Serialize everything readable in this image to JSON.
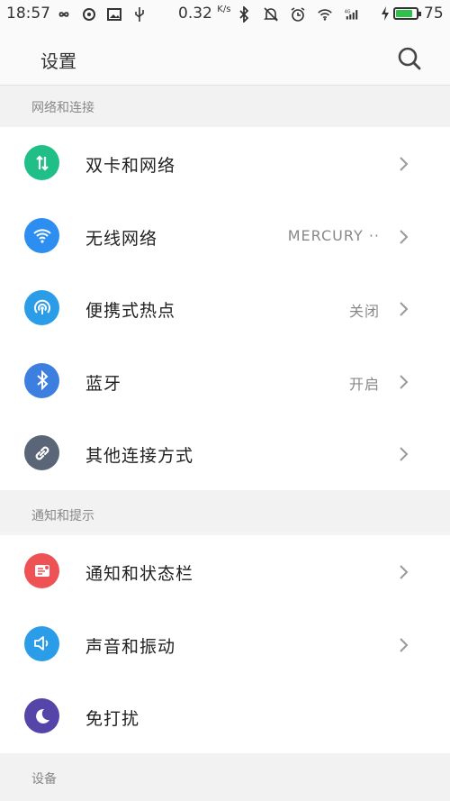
{
  "status_bar": {
    "time": "18:57",
    "net_speed": "0.32",
    "net_speed_unit": "K/s",
    "battery_level": "75",
    "battery_fill_fraction": 0.75,
    "left_icons": [
      "infinity-icon",
      "sync-icon",
      "image-icon",
      "usb-icon"
    ],
    "right_icons": [
      "bluetooth-icon",
      "mute-icon",
      "alarm-icon",
      "wifi-icon",
      "signal-4g-icon",
      "charging-icon"
    ]
  },
  "app_bar": {
    "title": "设置",
    "search_icon": "search-icon"
  },
  "sections": [
    {
      "header": "网络和连接",
      "items": [
        {
          "label": "双卡和网络",
          "value": "",
          "icon": "dual-sim-icon",
          "color": "#1fbf87"
        },
        {
          "label": "无线网络",
          "value": "MERCURY ··",
          "icon": "wifi-icon",
          "color": "#2b8ef0"
        },
        {
          "label": "便携式热点",
          "value": "关闭",
          "icon": "hotspot-icon",
          "color": "#2b9de8"
        },
        {
          "label": "蓝牙",
          "value": "开启",
          "icon": "bluetooth-icon",
          "color": "#3d7fe0"
        },
        {
          "label": "其他连接方式",
          "value": "",
          "icon": "link-icon",
          "color": "#5a6577"
        }
      ]
    },
    {
      "header": "通知和提示",
      "items": [
        {
          "label": "通知和状态栏",
          "value": "",
          "icon": "notification-icon",
          "color": "#ee5254"
        },
        {
          "label": "声音和振动",
          "value": "",
          "icon": "sound-icon",
          "color": "#2b9de8"
        },
        {
          "label": "免打扰",
          "value": "",
          "icon": "moon-icon",
          "color": "#5645a8"
        }
      ]
    },
    {
      "header": "设备",
      "items": []
    }
  ],
  "colors": {
    "background": "#f4f4f4",
    "list_bg": "#ffffff",
    "header_text": "#888888"
  }
}
